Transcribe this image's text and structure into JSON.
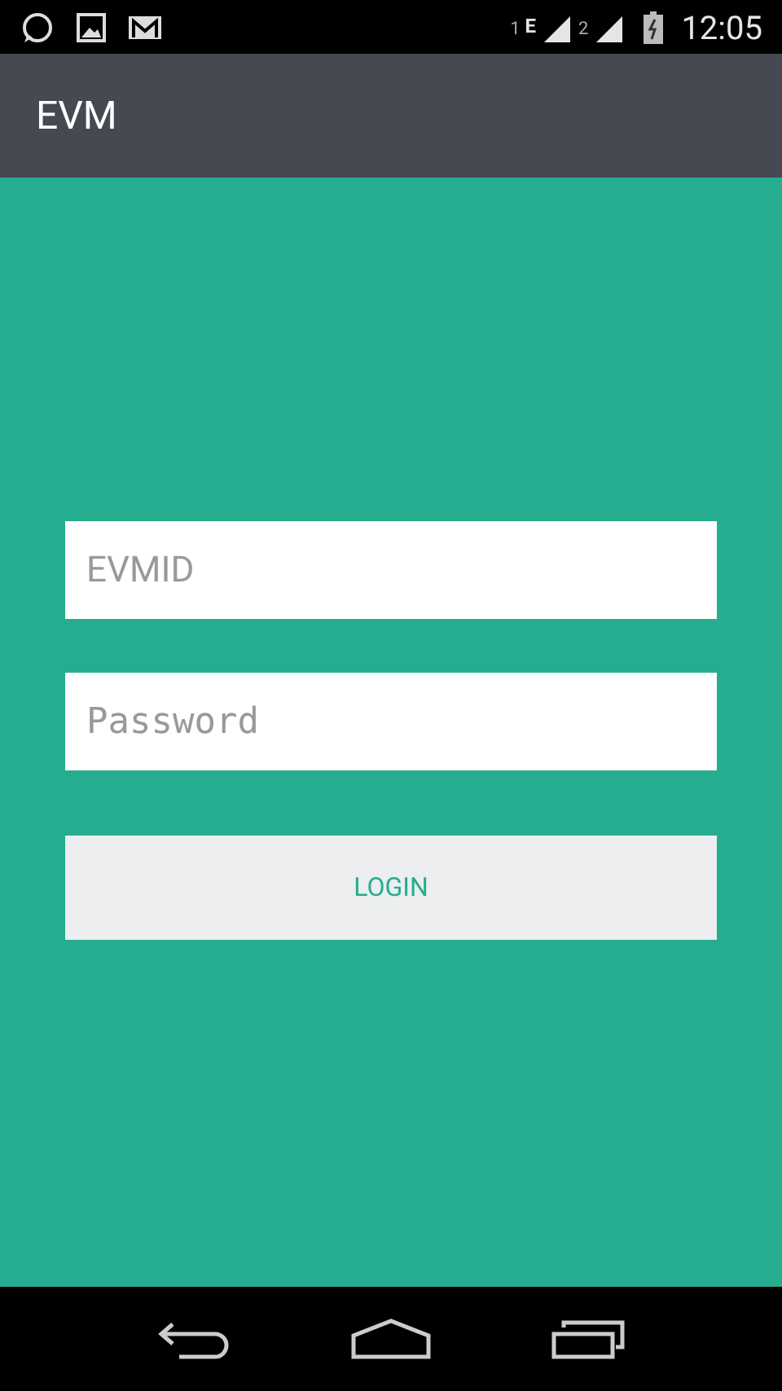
{
  "status_bar": {
    "sim1": "1",
    "network": "E",
    "sim2": "2",
    "time": "12:05"
  },
  "app_bar": {
    "title": "EVM"
  },
  "form": {
    "fields": [
      {
        "kind": "text",
        "placeholder": "EVMID"
      },
      {
        "kind": "password",
        "placeholder": "Password"
      }
    ],
    "button": "LOGIN"
  }
}
